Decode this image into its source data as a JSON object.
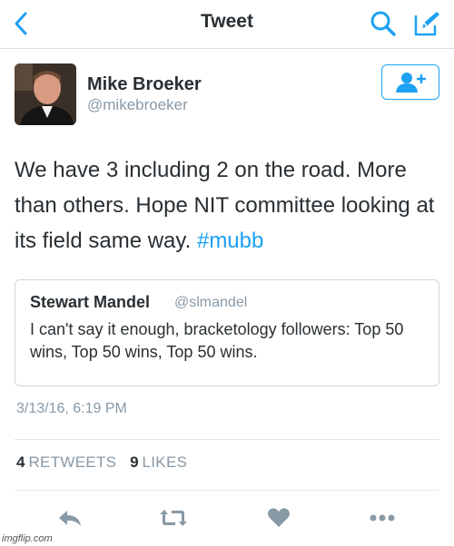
{
  "nav": {
    "title": "Tweet",
    "back_icon": "chevron-left-icon",
    "search_icon": "search-icon",
    "compose_icon": "compose-icon"
  },
  "tweet": {
    "author_name": "Mike Broeker",
    "author_handle": "@mikebroeker",
    "text_main": "We have 3 including 2 on the road. More than others. Hope NIT committee looking at its field same way.",
    "hashtag": "#mubb",
    "timestamp": "3/13/16, 6:19 PM"
  },
  "quote": {
    "author_name": "Stewart Mandel",
    "author_handle": "@slmandel",
    "text": "I can't say it enough, bracketology followers: Top 50 wins, Top 50 wins, Top 50 wins."
  },
  "stats": {
    "retweets_count": "4",
    "retweets_label": "RETWEETS",
    "likes_count": "9",
    "likes_label": "LIKES"
  },
  "watermark": "imgflip.com",
  "colors": {
    "accent": "#1da1f2",
    "muted": "#8899a6",
    "text": "#292f33",
    "border": "#ccd6dd"
  }
}
